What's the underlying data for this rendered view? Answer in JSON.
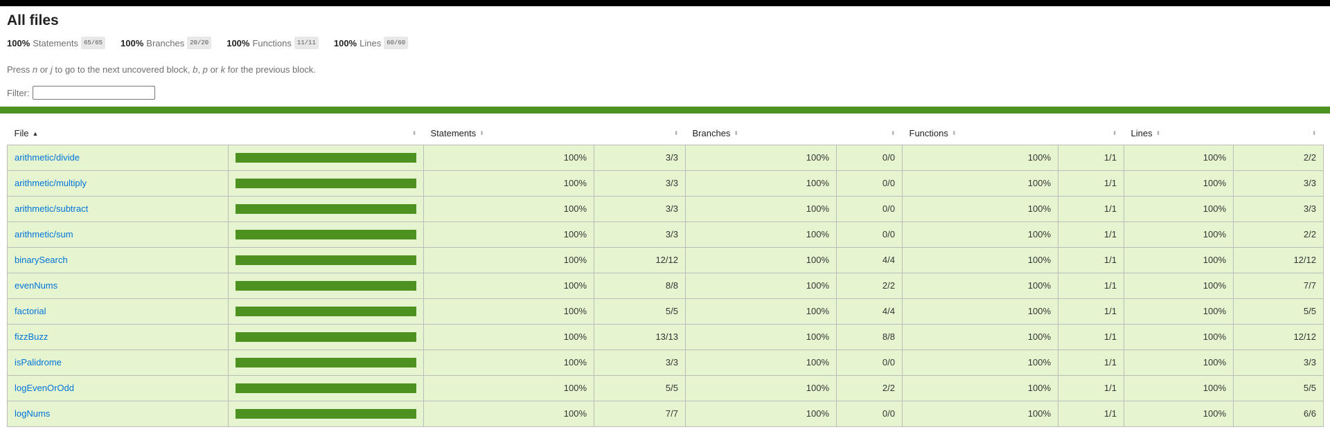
{
  "header": {
    "title": "All files",
    "summary": [
      {
        "pct": "100%",
        "label": "Statements",
        "fraction": "65/65"
      },
      {
        "pct": "100%",
        "label": "Branches",
        "fraction": "20/20"
      },
      {
        "pct": "100%",
        "label": "Functions",
        "fraction": "11/11"
      },
      {
        "pct": "100%",
        "label": "Lines",
        "fraction": "60/60"
      }
    ],
    "hint": {
      "press": "Press ",
      "key_n": "n",
      "or1": " or ",
      "key_j": "j",
      "mid": " to go to the next uncovered block, ",
      "key_b": "b",
      "comma": ", ",
      "key_p": "p",
      "or2": " or ",
      "key_k": "k",
      "end": " for the previous block."
    },
    "filter_label": "Filter:",
    "filter_value": ""
  },
  "colors": {
    "high_coverage": "#4d9221",
    "row_background": "#e6f5d0",
    "link": "#0074d9"
  },
  "table": {
    "columns": {
      "file": "File",
      "statements": "Statements",
      "branches": "Branches",
      "functions": "Functions",
      "lines": "Lines"
    },
    "sort": {
      "column": "file",
      "direction": "ascending"
    },
    "rows": [
      {
        "file": "arithmetic/divide",
        "coverage": 100,
        "stmt_pct": "100%",
        "stmt": "3/3",
        "br_pct": "100%",
        "br": "0/0",
        "fn_pct": "100%",
        "fn": "1/1",
        "ln_pct": "100%",
        "ln": "2/2"
      },
      {
        "file": "arithmetic/multiply",
        "coverage": 100,
        "stmt_pct": "100%",
        "stmt": "3/3",
        "br_pct": "100%",
        "br": "0/0",
        "fn_pct": "100%",
        "fn": "1/1",
        "ln_pct": "100%",
        "ln": "3/3"
      },
      {
        "file": "arithmetic/subtract",
        "coverage": 100,
        "stmt_pct": "100%",
        "stmt": "3/3",
        "br_pct": "100%",
        "br": "0/0",
        "fn_pct": "100%",
        "fn": "1/1",
        "ln_pct": "100%",
        "ln": "3/3"
      },
      {
        "file": "arithmetic/sum",
        "coverage": 100,
        "stmt_pct": "100%",
        "stmt": "3/3",
        "br_pct": "100%",
        "br": "0/0",
        "fn_pct": "100%",
        "fn": "1/1",
        "ln_pct": "100%",
        "ln": "2/2"
      },
      {
        "file": "binarySearch",
        "coverage": 100,
        "stmt_pct": "100%",
        "stmt": "12/12",
        "br_pct": "100%",
        "br": "4/4",
        "fn_pct": "100%",
        "fn": "1/1",
        "ln_pct": "100%",
        "ln": "12/12"
      },
      {
        "file": "evenNums",
        "coverage": 100,
        "stmt_pct": "100%",
        "stmt": "8/8",
        "br_pct": "100%",
        "br": "2/2",
        "fn_pct": "100%",
        "fn": "1/1",
        "ln_pct": "100%",
        "ln": "7/7"
      },
      {
        "file": "factorial",
        "coverage": 100,
        "stmt_pct": "100%",
        "stmt": "5/5",
        "br_pct": "100%",
        "br": "4/4",
        "fn_pct": "100%",
        "fn": "1/1",
        "ln_pct": "100%",
        "ln": "5/5"
      },
      {
        "file": "fizzBuzz",
        "coverage": 100,
        "stmt_pct": "100%",
        "stmt": "13/13",
        "br_pct": "100%",
        "br": "8/8",
        "fn_pct": "100%",
        "fn": "1/1",
        "ln_pct": "100%",
        "ln": "12/12"
      },
      {
        "file": "isPalidrome",
        "coverage": 100,
        "stmt_pct": "100%",
        "stmt": "3/3",
        "br_pct": "100%",
        "br": "0/0",
        "fn_pct": "100%",
        "fn": "1/1",
        "ln_pct": "100%",
        "ln": "3/3"
      },
      {
        "file": "logEvenOrOdd",
        "coverage": 100,
        "stmt_pct": "100%",
        "stmt": "5/5",
        "br_pct": "100%",
        "br": "2/2",
        "fn_pct": "100%",
        "fn": "1/1",
        "ln_pct": "100%",
        "ln": "5/5"
      },
      {
        "file": "logNums",
        "coverage": 100,
        "stmt_pct": "100%",
        "stmt": "7/7",
        "br_pct": "100%",
        "br": "0/0",
        "fn_pct": "100%",
        "fn": "1/1",
        "ln_pct": "100%",
        "ln": "6/6"
      }
    ]
  }
}
